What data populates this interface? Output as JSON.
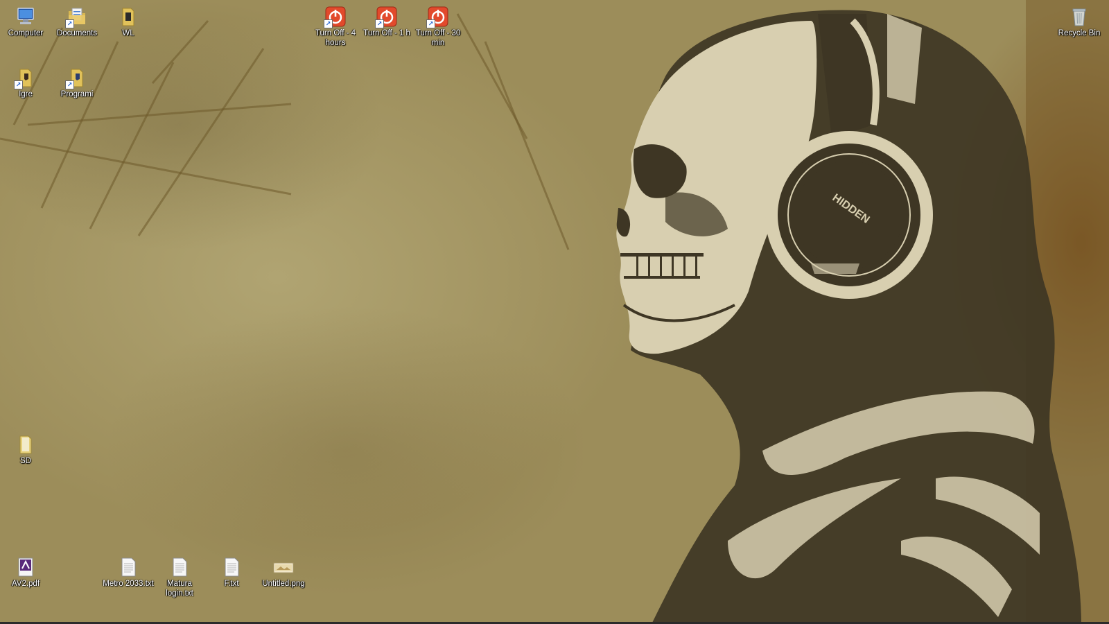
{
  "desktop": {
    "wallpaper": {
      "theme": "skull-with-headphones",
      "headphone_brand_text": "HIDDEN"
    },
    "icons": [
      {
        "id": "computer",
        "label": "Computer",
        "icon": "computer-icon"
      },
      {
        "id": "documents",
        "label": "Documents",
        "icon": "documents-folder-icon"
      },
      {
        "id": "wl",
        "label": "WL",
        "icon": "folder-icon"
      },
      {
        "id": "turnoff-4h",
        "label": "Turn Off - 4 hours",
        "icon": "power-shortcut-icon"
      },
      {
        "id": "turnoff-1h",
        "label": "Turn Off - 1 h",
        "icon": "power-shortcut-icon"
      },
      {
        "id": "turnoff-30m",
        "label": "Turn Off - 30 min",
        "icon": "power-shortcut-icon"
      },
      {
        "id": "recycle-bin",
        "label": "Recycle Bin",
        "icon": "recycle-bin-icon"
      },
      {
        "id": "igre",
        "label": "Igre",
        "icon": "folder-shortcut-icon"
      },
      {
        "id": "programi",
        "label": "Programi",
        "icon": "folder-shortcut-icon"
      },
      {
        "id": "sd",
        "label": "SD",
        "icon": "folder-icon"
      },
      {
        "id": "av2pdf",
        "label": "AV2.pdf",
        "icon": "pdf-file-icon"
      },
      {
        "id": "metro",
        "label": "Metro 2033.txt",
        "icon": "text-file-icon"
      },
      {
        "id": "matura",
        "label": "Matura login.txt",
        "icon": "text-file-icon"
      },
      {
        "id": "ftxt",
        "label": "F.txt",
        "icon": "text-file-icon"
      },
      {
        "id": "untitled",
        "label": "Untitled.png",
        "icon": "image-file-icon"
      }
    ]
  },
  "colors": {
    "wallpaper_base": "#a29460",
    "wallpaper_ink": "#3e3624",
    "wallpaper_bone": "#d8cfb0",
    "power_red": "#e24a2c",
    "label_text": "#ffffff"
  }
}
